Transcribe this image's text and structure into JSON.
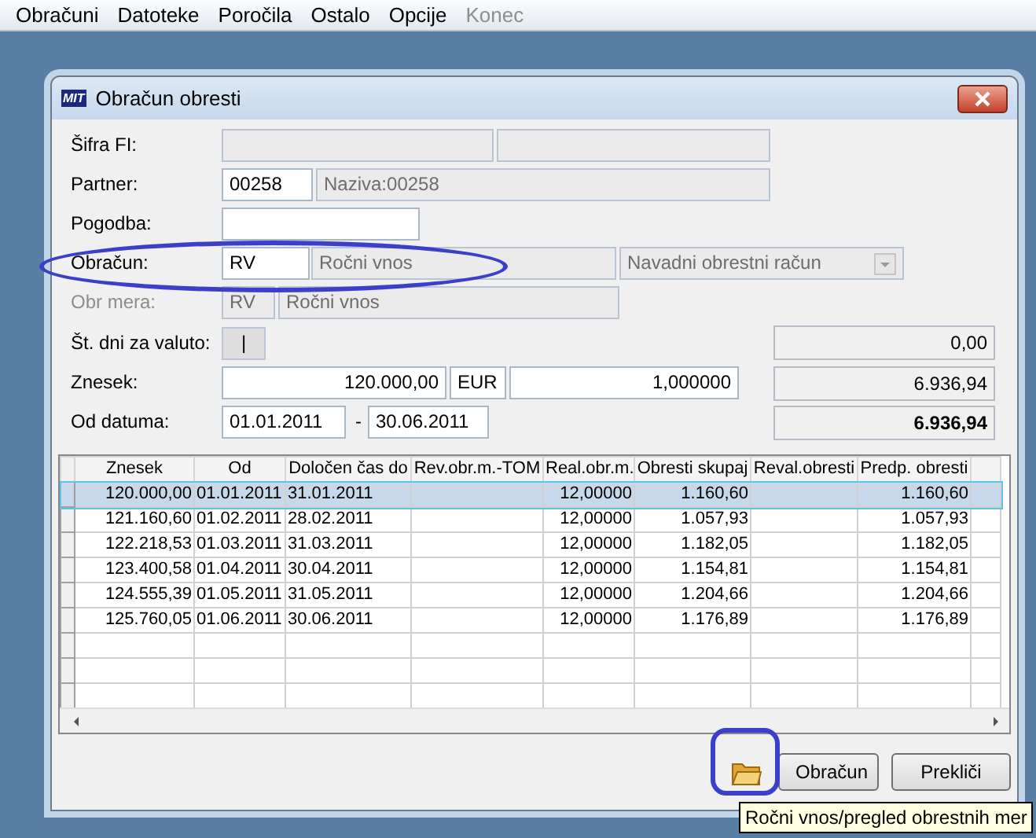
{
  "menu": [
    {
      "label": "Obračuni",
      "disabled": false
    },
    {
      "label": "Datoteke",
      "disabled": false
    },
    {
      "label": "Poročila",
      "disabled": false
    },
    {
      "label": "Ostalo",
      "disabled": false
    },
    {
      "label": "Opcije",
      "disabled": false
    },
    {
      "label": "Konec",
      "disabled": true
    }
  ],
  "dialog": {
    "title": "Obračun obresti",
    "logo": "MIT"
  },
  "form": {
    "sifra_fi": {
      "label": "Šifra FI:"
    },
    "partner": {
      "label": "Partner:",
      "code": "00258",
      "name": "Naziva:00258"
    },
    "pogodba": {
      "label": "Pogodba:"
    },
    "obracun": {
      "label": "Obračun:",
      "code": "RV",
      "name": "Ročni vnos",
      "type": "Navadni obrestni račun"
    },
    "obr_mera": {
      "label": "Obr mera:",
      "disabled": true,
      "code": "RV",
      "name": "Ročni vnos"
    },
    "st_dni": {
      "label": "Št. dni za valuto:",
      "value": "|"
    },
    "znesek": {
      "label": "Znesek:",
      "amount": "120.000,00",
      "currency": "EUR",
      "rate": "1,000000"
    },
    "od_datuma": {
      "label": "Od datuma:",
      "from": "01.01.2011",
      "separator": "-",
      "to": "30.06.2011"
    }
  },
  "totals": [
    {
      "value": "0,00",
      "emphasized": false
    },
    {
      "value": "6.936,94",
      "emphasized": false
    },
    {
      "value": "6.936,94",
      "emphasized": true
    }
  ],
  "table": {
    "columns": [
      "Znesek",
      "Od",
      "Določen čas do",
      "Rev.obr.m.-TOM",
      "Real.obr.m.",
      "Obresti skupaj",
      "Reval.obresti",
      "Predp. obresti"
    ],
    "rows": [
      {
        "selected": true,
        "cells": [
          "120.000,00",
          "01.01.2011",
          "31.01.2011",
          "",
          "12,00000",
          "1.160,60",
          "",
          "1.160,60"
        ]
      },
      {
        "selected": false,
        "cells": [
          "121.160,60",
          "01.02.2011",
          "28.02.2011",
          "",
          "12,00000",
          "1.057,93",
          "",
          "1.057,93"
        ]
      },
      {
        "selected": false,
        "cells": [
          "122.218,53",
          "01.03.2011",
          "31.03.2011",
          "",
          "12,00000",
          "1.182,05",
          "",
          "1.182,05"
        ]
      },
      {
        "selected": false,
        "cells": [
          "123.400,58",
          "01.04.2011",
          "30.04.2011",
          "",
          "12,00000",
          "1.154,81",
          "",
          "1.154,81"
        ]
      },
      {
        "selected": false,
        "cells": [
          "124.555,39",
          "01.05.2011",
          "31.05.2011",
          "",
          "12,00000",
          "1.204,66",
          "",
          "1.204,66"
        ]
      },
      {
        "selected": false,
        "cells": [
          "125.760,05",
          "01.06.2011",
          "30.06.2011",
          "",
          "12,00000",
          "1.176,89",
          "",
          "1.176,89"
        ]
      }
    ]
  },
  "buttons": [
    {
      "label": "Obračun"
    },
    {
      "label": "Prekliči"
    }
  ],
  "tooltip": "Ročni vnos/pregled obrestnih mer"
}
